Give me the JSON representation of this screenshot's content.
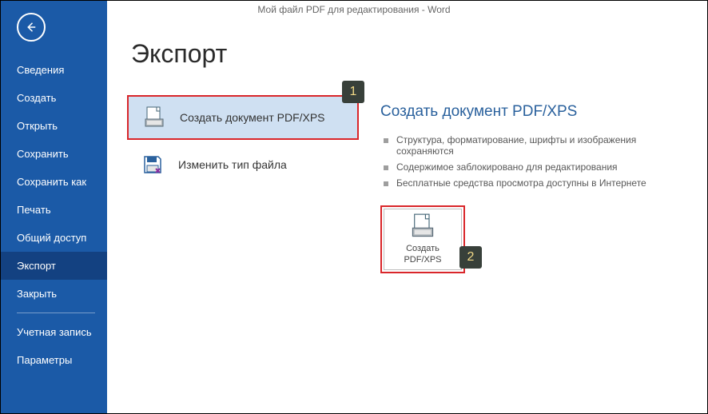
{
  "window": {
    "title": "Мой файл PDF для редактирования - Word"
  },
  "sidebar": {
    "items": [
      {
        "label": "Сведения"
      },
      {
        "label": "Создать"
      },
      {
        "label": "Открыть"
      },
      {
        "label": "Сохранить"
      },
      {
        "label": "Сохранить как"
      },
      {
        "label": "Печать"
      },
      {
        "label": "Общий доступ"
      },
      {
        "label": "Экспорт"
      },
      {
        "label": "Закрыть"
      }
    ],
    "bottom": [
      {
        "label": "Учетная запись"
      },
      {
        "label": "Параметры"
      }
    ]
  },
  "main": {
    "heading": "Экспорт",
    "options": [
      {
        "label": "Создать документ PDF/XPS"
      },
      {
        "label": "Изменить тип файла"
      }
    ]
  },
  "pane": {
    "title": "Создать документ PDF/XPS",
    "bullets": [
      "Структура, форматирование, шрифты и изображения сохраняются",
      "Содержимое заблокировано для редактирования",
      "Бесплатные средства просмотра доступны в Интернете"
    ],
    "action": {
      "line1": "Создать",
      "line2": "PDF/XPS"
    }
  },
  "markers": {
    "m1": "1",
    "m2": "2"
  }
}
